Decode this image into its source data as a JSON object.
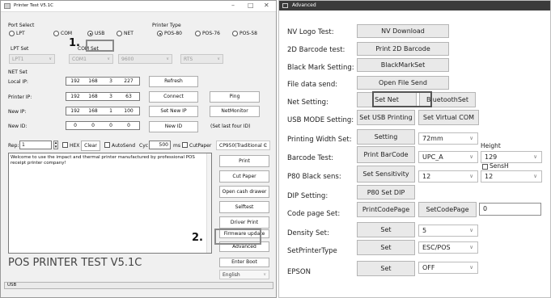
{
  "left_window": {
    "title": "Printer Test V5.1C",
    "controls": {
      "minimize": "–",
      "maximize": "□",
      "close": "✕"
    },
    "port_select": {
      "label": "Port Select",
      "options": [
        "LPT",
        "COM",
        "USB",
        "NET"
      ],
      "selected": "USB"
    },
    "printer_type": {
      "label": "Printer Type",
      "options": [
        "POS-80",
        "POS-76",
        "POS-58"
      ],
      "selected": "POS-80"
    },
    "lpt_set": {
      "label": "LPT Set",
      "value": "LPT1"
    },
    "com_set": {
      "label": "COM Set",
      "port": "COM1",
      "baud": "9600",
      "flow": "RTS"
    },
    "net_set": {
      "label": "NET Set",
      "local_ip": {
        "label": "Local IP:",
        "octets": [
          "192",
          "168",
          "3",
          "227"
        ]
      },
      "printer_ip": {
        "label": "Printer IP:",
        "octets": [
          "192",
          "168",
          "3",
          "63"
        ]
      },
      "new_ip": {
        "label": "New IP:",
        "octets": [
          "192",
          "168",
          "1",
          "100"
        ]
      },
      "new_id": {
        "label": "New ID:",
        "octets": [
          "0",
          "0",
          "0",
          "0"
        ]
      },
      "buttons": {
        "refresh": "Refresh",
        "connect": "Connect",
        "ping": "Ping",
        "set_new_ip": "Set New IP",
        "netmonitor": "NetMonitor",
        "new_id": "New ID",
        "set_last_four": "(Set last four ID)"
      }
    },
    "rep": {
      "label": "Rep:",
      "value": "1",
      "hex_label": "HEX",
      "clear": "Clear",
      "autosend_label": "AutoSend",
      "cyc_label": "Cyc",
      "cyc_value": "500",
      "ms_label": "ms",
      "cutpaper_label": "CutPaper",
      "codepage": "CP950(Traditional C"
    },
    "message": "Welcome to use the impact and thermal printer manufactured by professional POS receipt printer company!",
    "side_buttons": {
      "print": "Print",
      "cut_paper": "Cut Paper",
      "open_cash_drawer": "Open cash drawer",
      "selftest": "Selftest",
      "driver_print": "Driver Print",
      "firmware_update": "Firmware update",
      "advanced": "Advanced",
      "enter_boot": "Enter Boot"
    },
    "language": "English",
    "app_banner": "POS PRINTER TEST V5.1C",
    "status": "USB",
    "step_labels": [
      "1.",
      "2."
    ]
  },
  "right_window": {
    "title": "Advanced",
    "rows": {
      "nv_logo": {
        "label": "NV Logo Test:",
        "button": "NV Download"
      },
      "barcode_2d": {
        "label": "2D Barcode test:",
        "button": "Print 2D Barcode"
      },
      "black_mark": {
        "label": "Black Mark Setting:",
        "button": "BlackMarkSet"
      },
      "file_send": {
        "label": "File data send:",
        "button": "Open File Send"
      },
      "net": {
        "label": "Net Setting:",
        "button": "Set Net",
        "button2": "BluetoothSet"
      },
      "usb_mode": {
        "label": "USB MODE Setting:",
        "button": "Set USB Printing",
        "button2": "Set Virtual COM"
      },
      "print_width": {
        "label": "Printing Width Set:",
        "button": "Setting",
        "select": "72mm"
      },
      "barcode": {
        "label": "Barcode Test:",
        "button": "Print BarCode",
        "select": "UPC_A",
        "height_label": "Height",
        "height_value": "129"
      },
      "p80_black": {
        "label": "P80 Black sens:",
        "button": "Set Sensitivity",
        "select": "12",
        "sensh_label": "SensH",
        "sensh_value": "12"
      },
      "dip": {
        "label": "DIP Setting:",
        "button": "P80 Set DIP"
      },
      "code_page": {
        "label": "Code page Set:",
        "button": "PrintCodePage",
        "button2": "SetCodePage",
        "input": "0"
      },
      "density": {
        "label": "Density Set:",
        "button": "Set",
        "select": "5"
      },
      "printer_type": {
        "label": "SetPrinterType",
        "button": "Set",
        "select": "ESC/POS"
      },
      "epson": {
        "label": "EPSON",
        "button": "Set",
        "select": "OFF"
      }
    }
  }
}
